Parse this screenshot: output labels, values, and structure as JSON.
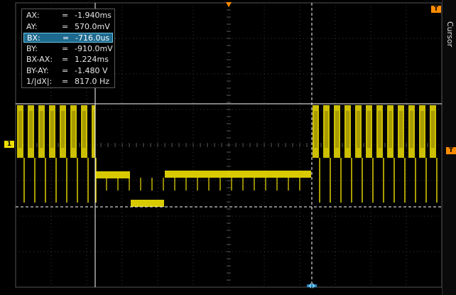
{
  "cursor_readout": {
    "rows": [
      {
        "label": "AX:",
        "eq": "=",
        "value": "-1.940ms"
      },
      {
        "label": "AY:",
        "eq": "=",
        "value": "570.0mV"
      },
      {
        "label": "BX:",
        "eq": "=",
        "value": "-716.0us"
      },
      {
        "label": "BY:",
        "eq": "=",
        "value": "-910.0mV"
      },
      {
        "label": "BX-AX:",
        "eq": "=",
        "value": "1.224ms"
      },
      {
        "label": "BY-AY:",
        "eq": "=",
        "value": "-1.480 V"
      },
      {
        "label": "1/|dX|:",
        "eq": "=",
        "value": "817.0 Hz"
      }
    ],
    "active_row": 2
  },
  "side_panel": {
    "title": "Cursor"
  },
  "markers": {
    "channel_label": "1",
    "trigger_label": "T",
    "top_right_label": "T"
  },
  "colors": {
    "trace": "#f0e000",
    "grid": "#3a3a3a",
    "cursor": "#ffffff",
    "marker": "#ff8c00",
    "channel": "#f0e000"
  }
}
